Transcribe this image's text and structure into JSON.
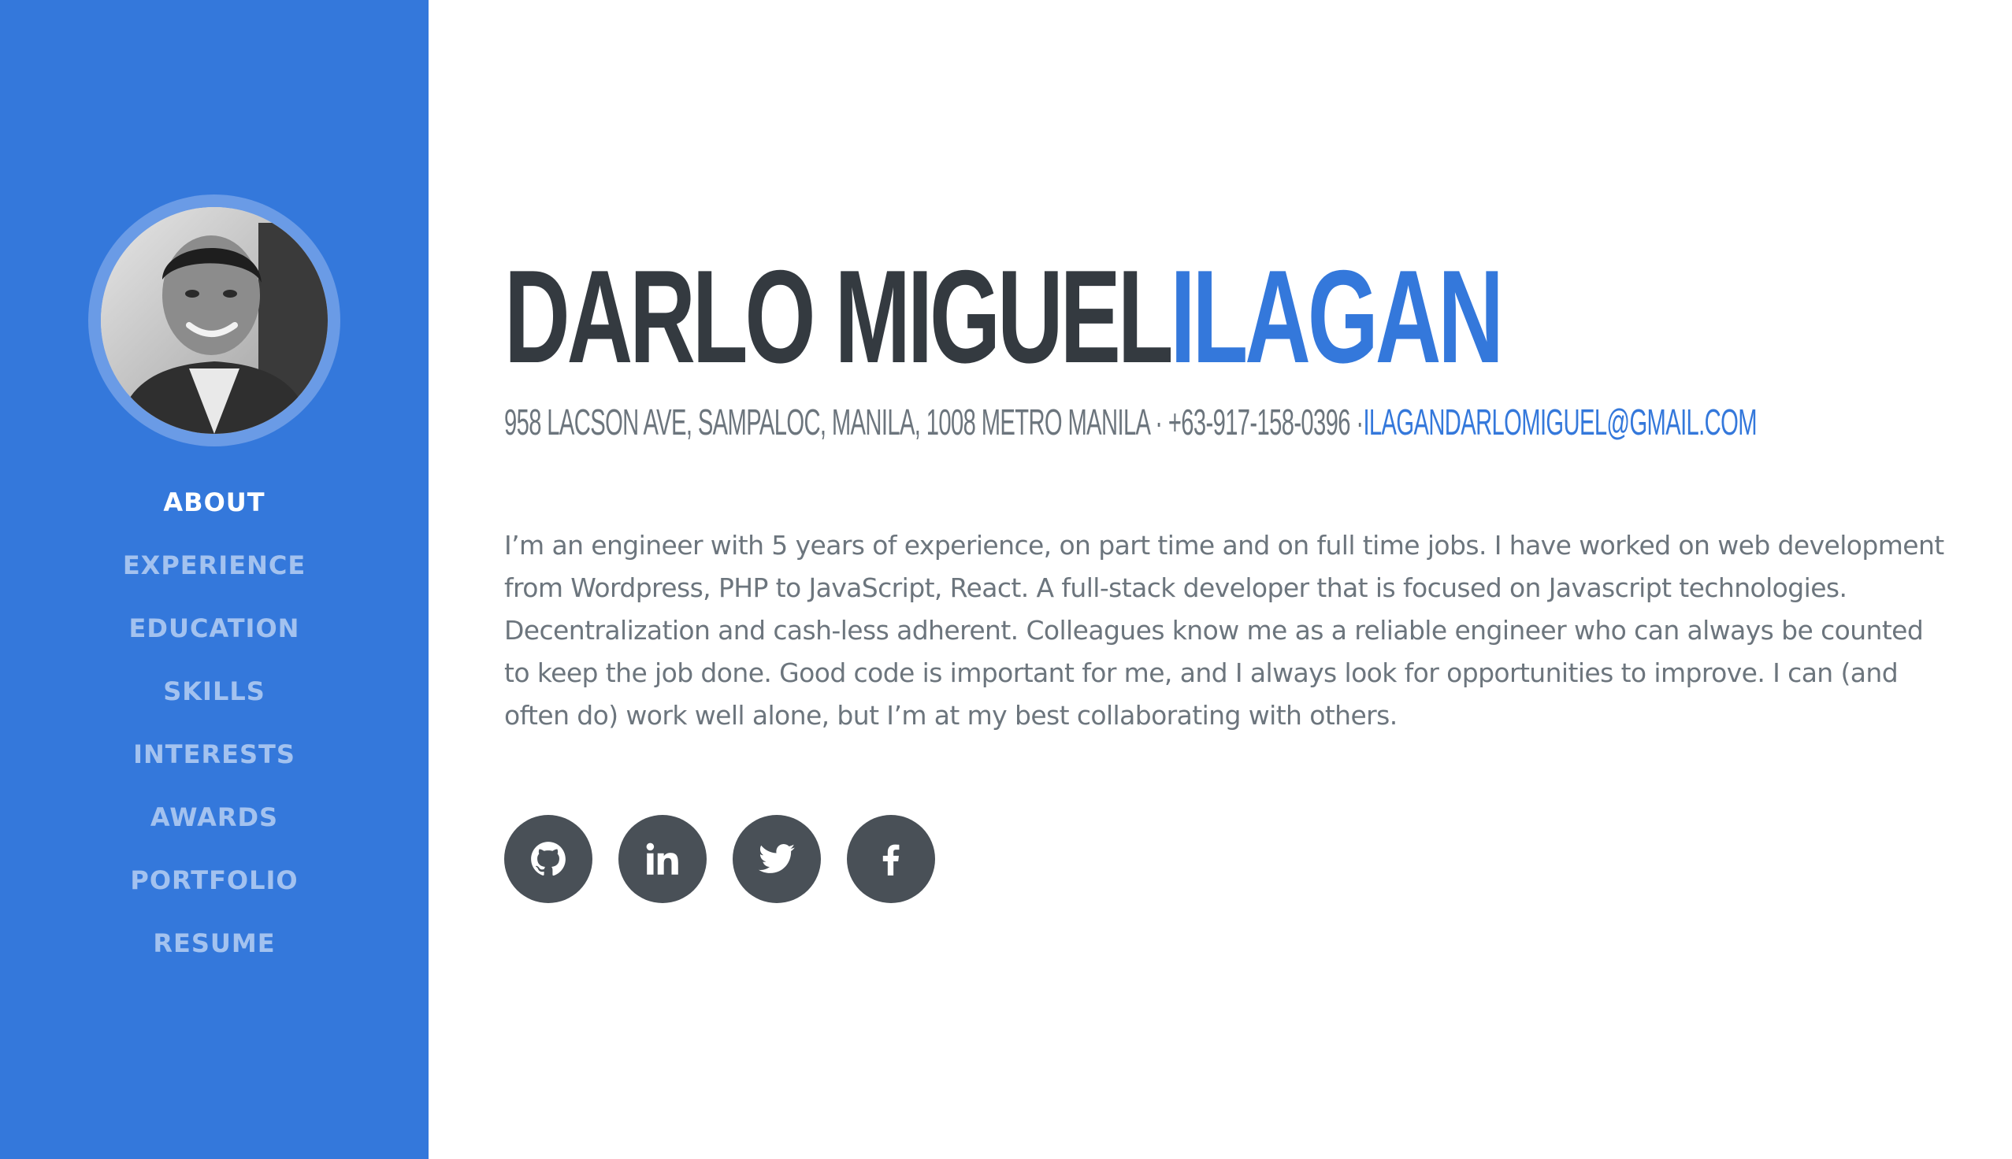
{
  "profile": {
    "first_name": "DARLO MIGUEL",
    "last_name": "ILAGAN",
    "address": "958 LACSON AVE, SAMPALOC, MANILA, 1008 METRO MANILA · +63-917-158-0396 ·",
    "email": "ILAGANDARLOMIGUEL@GMAIL.COM",
    "bio": "I’m an engineer with 5 years of experience, on part time and on full time jobs. I have worked on web development from Wordpress, PHP to JavaScript, React. A full-stack developer that is focused on Javascript technologies. Decentralization and cash-less adherent. Colleagues know me as a reliable engineer who can always be counted to keep the job done. Good code is important for me, and I always look for opportunities to improve. I can (and often do) work well alone, but I’m at my best collaborating with others."
  },
  "sidebar": {
    "nav": [
      {
        "label": "ABOUT",
        "active": true
      },
      {
        "label": "EXPERIENCE",
        "active": false
      },
      {
        "label": "EDUCATION",
        "active": false
      },
      {
        "label": "SKILLS",
        "active": false
      },
      {
        "label": "INTERESTS",
        "active": false
      },
      {
        "label": "AWARDS",
        "active": false
      },
      {
        "label": "PORTFOLIO",
        "active": false
      },
      {
        "label": "RESUME",
        "active": false
      }
    ]
  },
  "socials": [
    {
      "icon": "github-icon"
    },
    {
      "icon": "linkedin-icon"
    },
    {
      "icon": "twitter-icon"
    },
    {
      "icon": "facebook-icon"
    }
  ],
  "colors": {
    "primary": "#3478db",
    "sidebar_bg": "#3478db",
    "heading": "#343a40",
    "muted": "#6c757d",
    "social_bg": "#495057"
  }
}
